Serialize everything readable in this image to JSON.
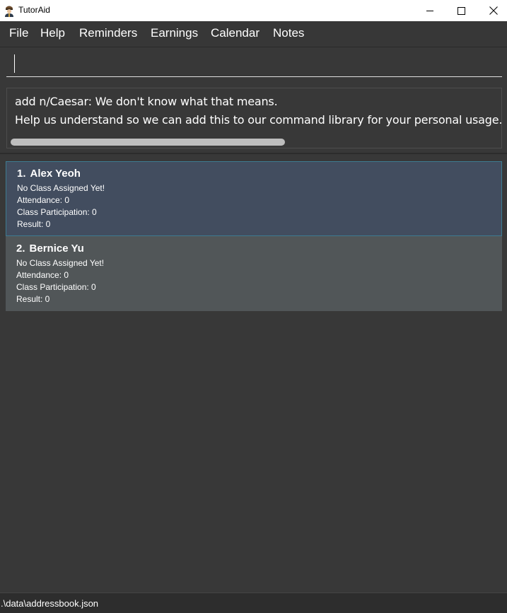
{
  "window": {
    "title": "TutorAid",
    "icon": "tutor-person-icon",
    "controls": [
      "minimize-icon",
      "maximize-icon",
      "close-icon"
    ]
  },
  "menu": {
    "items": [
      {
        "label": "File"
      },
      {
        "label": "Help"
      },
      {
        "label": "Reminders"
      },
      {
        "label": "Earnings"
      },
      {
        "label": "Calendar"
      },
      {
        "label": "Notes"
      }
    ]
  },
  "command": {
    "value": "",
    "placeholder": ""
  },
  "result": {
    "line1": "add n/Caesar: We don't know what that means.",
    "line2": "Help us understand so we can add this to our command library for your personal usage. Please"
  },
  "persons": [
    {
      "index": "1.",
      "name": "Alex Yeoh",
      "class": "No Class Assigned Yet!",
      "attendance": "Attendance: 0",
      "participation": "Class Participation: 0",
      "result": "Result: 0",
      "selected": true
    },
    {
      "index": "2.",
      "name": "Bernice Yu",
      "class": "No Class Assigned Yet!",
      "attendance": "Attendance: 0",
      "participation": "Class Participation: 0",
      "result": "Result: 0",
      "selected": false
    }
  ],
  "status": {
    "path": ".\\data\\addressbook.json"
  },
  "colors": {
    "background": "#383838",
    "selected_card": "#424d5f",
    "selected_border": "#3e7b91",
    "card": "#515658",
    "text": "#ffffff"
  }
}
